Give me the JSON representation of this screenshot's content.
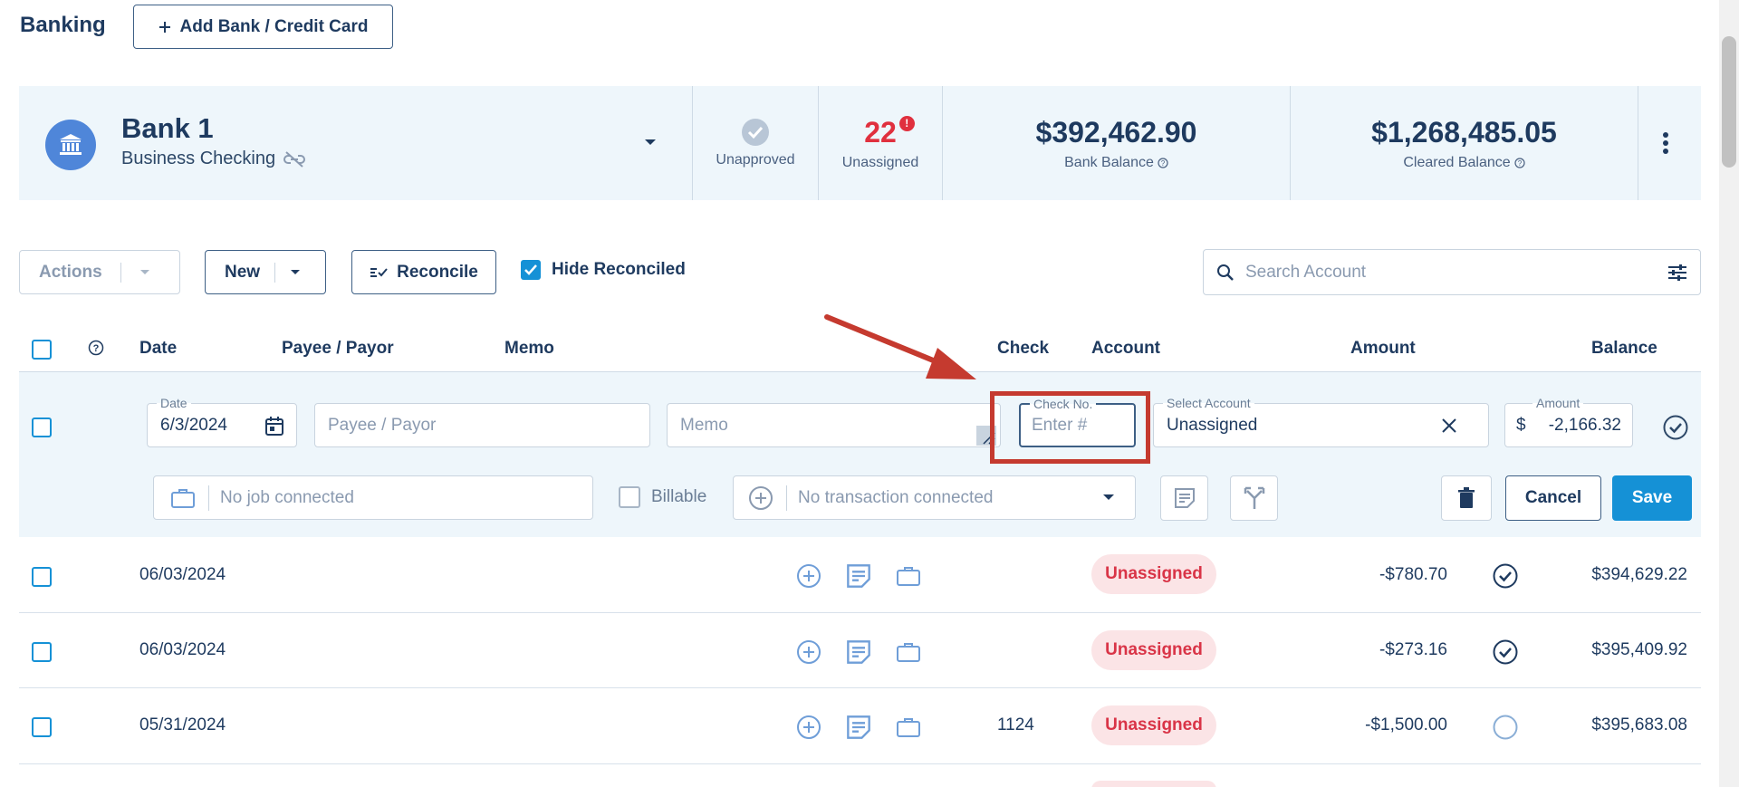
{
  "header": {
    "title": "Banking",
    "add_bank_label": "Add Bank / Credit Card"
  },
  "account": {
    "name": "Bank 1",
    "type": "Business Checking",
    "unapproved_label": "Unapproved",
    "unassigned_count": "22",
    "unassigned_alert": "!",
    "unassigned_label": "Unassigned",
    "bank_balance": "$392,462.90",
    "bank_balance_label": "Bank Balance",
    "cleared_balance": "$1,268,485.05",
    "cleared_balance_label": "Cleared Balance"
  },
  "toolbar": {
    "actions_label": "Actions",
    "new_label": "New",
    "reconcile_label": "Reconcile",
    "hide_reconciled_label": "Hide Reconciled",
    "hide_reconciled_checked": true,
    "search_placeholder": "Search Account"
  },
  "table": {
    "headers": {
      "date": "Date",
      "payee": "Payee / Payor",
      "memo": "Memo",
      "check": "Check",
      "account": "Account",
      "amount": "Amount",
      "balance": "Balance"
    }
  },
  "edit_row": {
    "date_label": "Date",
    "date_value": "6/3/2024",
    "payee_placeholder": "Payee / Payor",
    "memo_placeholder": "Memo",
    "check_label": "Check No.",
    "check_placeholder": "Enter #",
    "account_label": "Select Account",
    "account_value": "Unassigned",
    "amount_label": "Amount",
    "currency_symbol": "$",
    "amount_value": "-2,166.32",
    "job_placeholder": "No job connected",
    "billable_label": "Billable",
    "transaction_placeholder": "No transaction connected",
    "cancel_label": "Cancel",
    "save_label": "Save"
  },
  "rows": [
    {
      "date": "06/03/2024",
      "check": "",
      "account": "Unassigned",
      "amount": "-$780.70",
      "cleared": true,
      "balance": "$394,629.22"
    },
    {
      "date": "06/03/2024",
      "check": "",
      "account": "Unassigned",
      "amount": "-$273.16",
      "cleared": true,
      "balance": "$395,409.92"
    },
    {
      "date": "05/31/2024",
      "check": "1124",
      "account": "Unassigned",
      "amount": "-$1,500.00",
      "cleared": false,
      "balance": "$395,683.08"
    }
  ],
  "colors": {
    "primary": "#1e3a5f",
    "accent": "#1591d6",
    "danger": "#e0303e",
    "panel": "#eef6fb",
    "annotation": "#c53a2f"
  }
}
